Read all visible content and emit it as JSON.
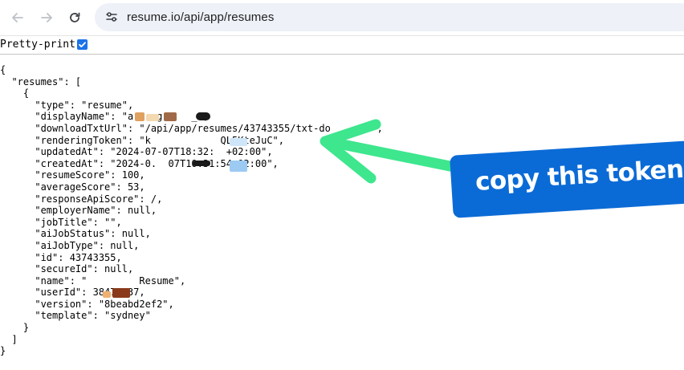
{
  "browser": {
    "url": "resume.io/api/app/resumes",
    "back_icon": "arrow-left-icon",
    "forward_icon": "arrow-right-icon",
    "reload_icon": "reload-icon",
    "site_info_icon": "tune-icon"
  },
  "pretty_print": {
    "label": "Pretty-print",
    "checked": true
  },
  "json_lines": [
    "{",
    "  \"resumes\": [",
    "    {",
    "      \"type\": \"resume\",",
    "      \"displayName\": \"a    g     _\",",
    "      \"downloadTxtUrl\": \"/api/app/resumes/43743355/txt-do    oad\",",
    "      \"renderingToken\": \"k            QL5KteJuC\",",
    "      \"updatedAt\": \"2024-07-07T18:32:  +02:00\",",
    "      \"createdAt\": \"2024-0.  07T10:31:54+02:00\",",
    "      \"resumeScore\": 100,",
    "      \"averageScore\": 53,",
    "      \"responseApiScore\": /,",
    "      \"employerName\": null,",
    "      \"jobTitle\": \"\",",
    "      \"aiJobStatus\": null,",
    "      \"aiJobType\": null,",
    "      \"id\": 43743355,",
    "      \"secureId\": null,",
    "      \"name\": \"         Resume\",",
    "      \"userId\": 3847  37,",
    "      \"version\": \"8beabd2ef2\",",
    "      \"template\": \"sydney\"",
    "    }",
    "  ]",
    "}"
  ],
  "annotation": {
    "callout_text": "copy this token",
    "arrow_color": "#3ee68e",
    "callout_color": "#0b6bd6"
  }
}
